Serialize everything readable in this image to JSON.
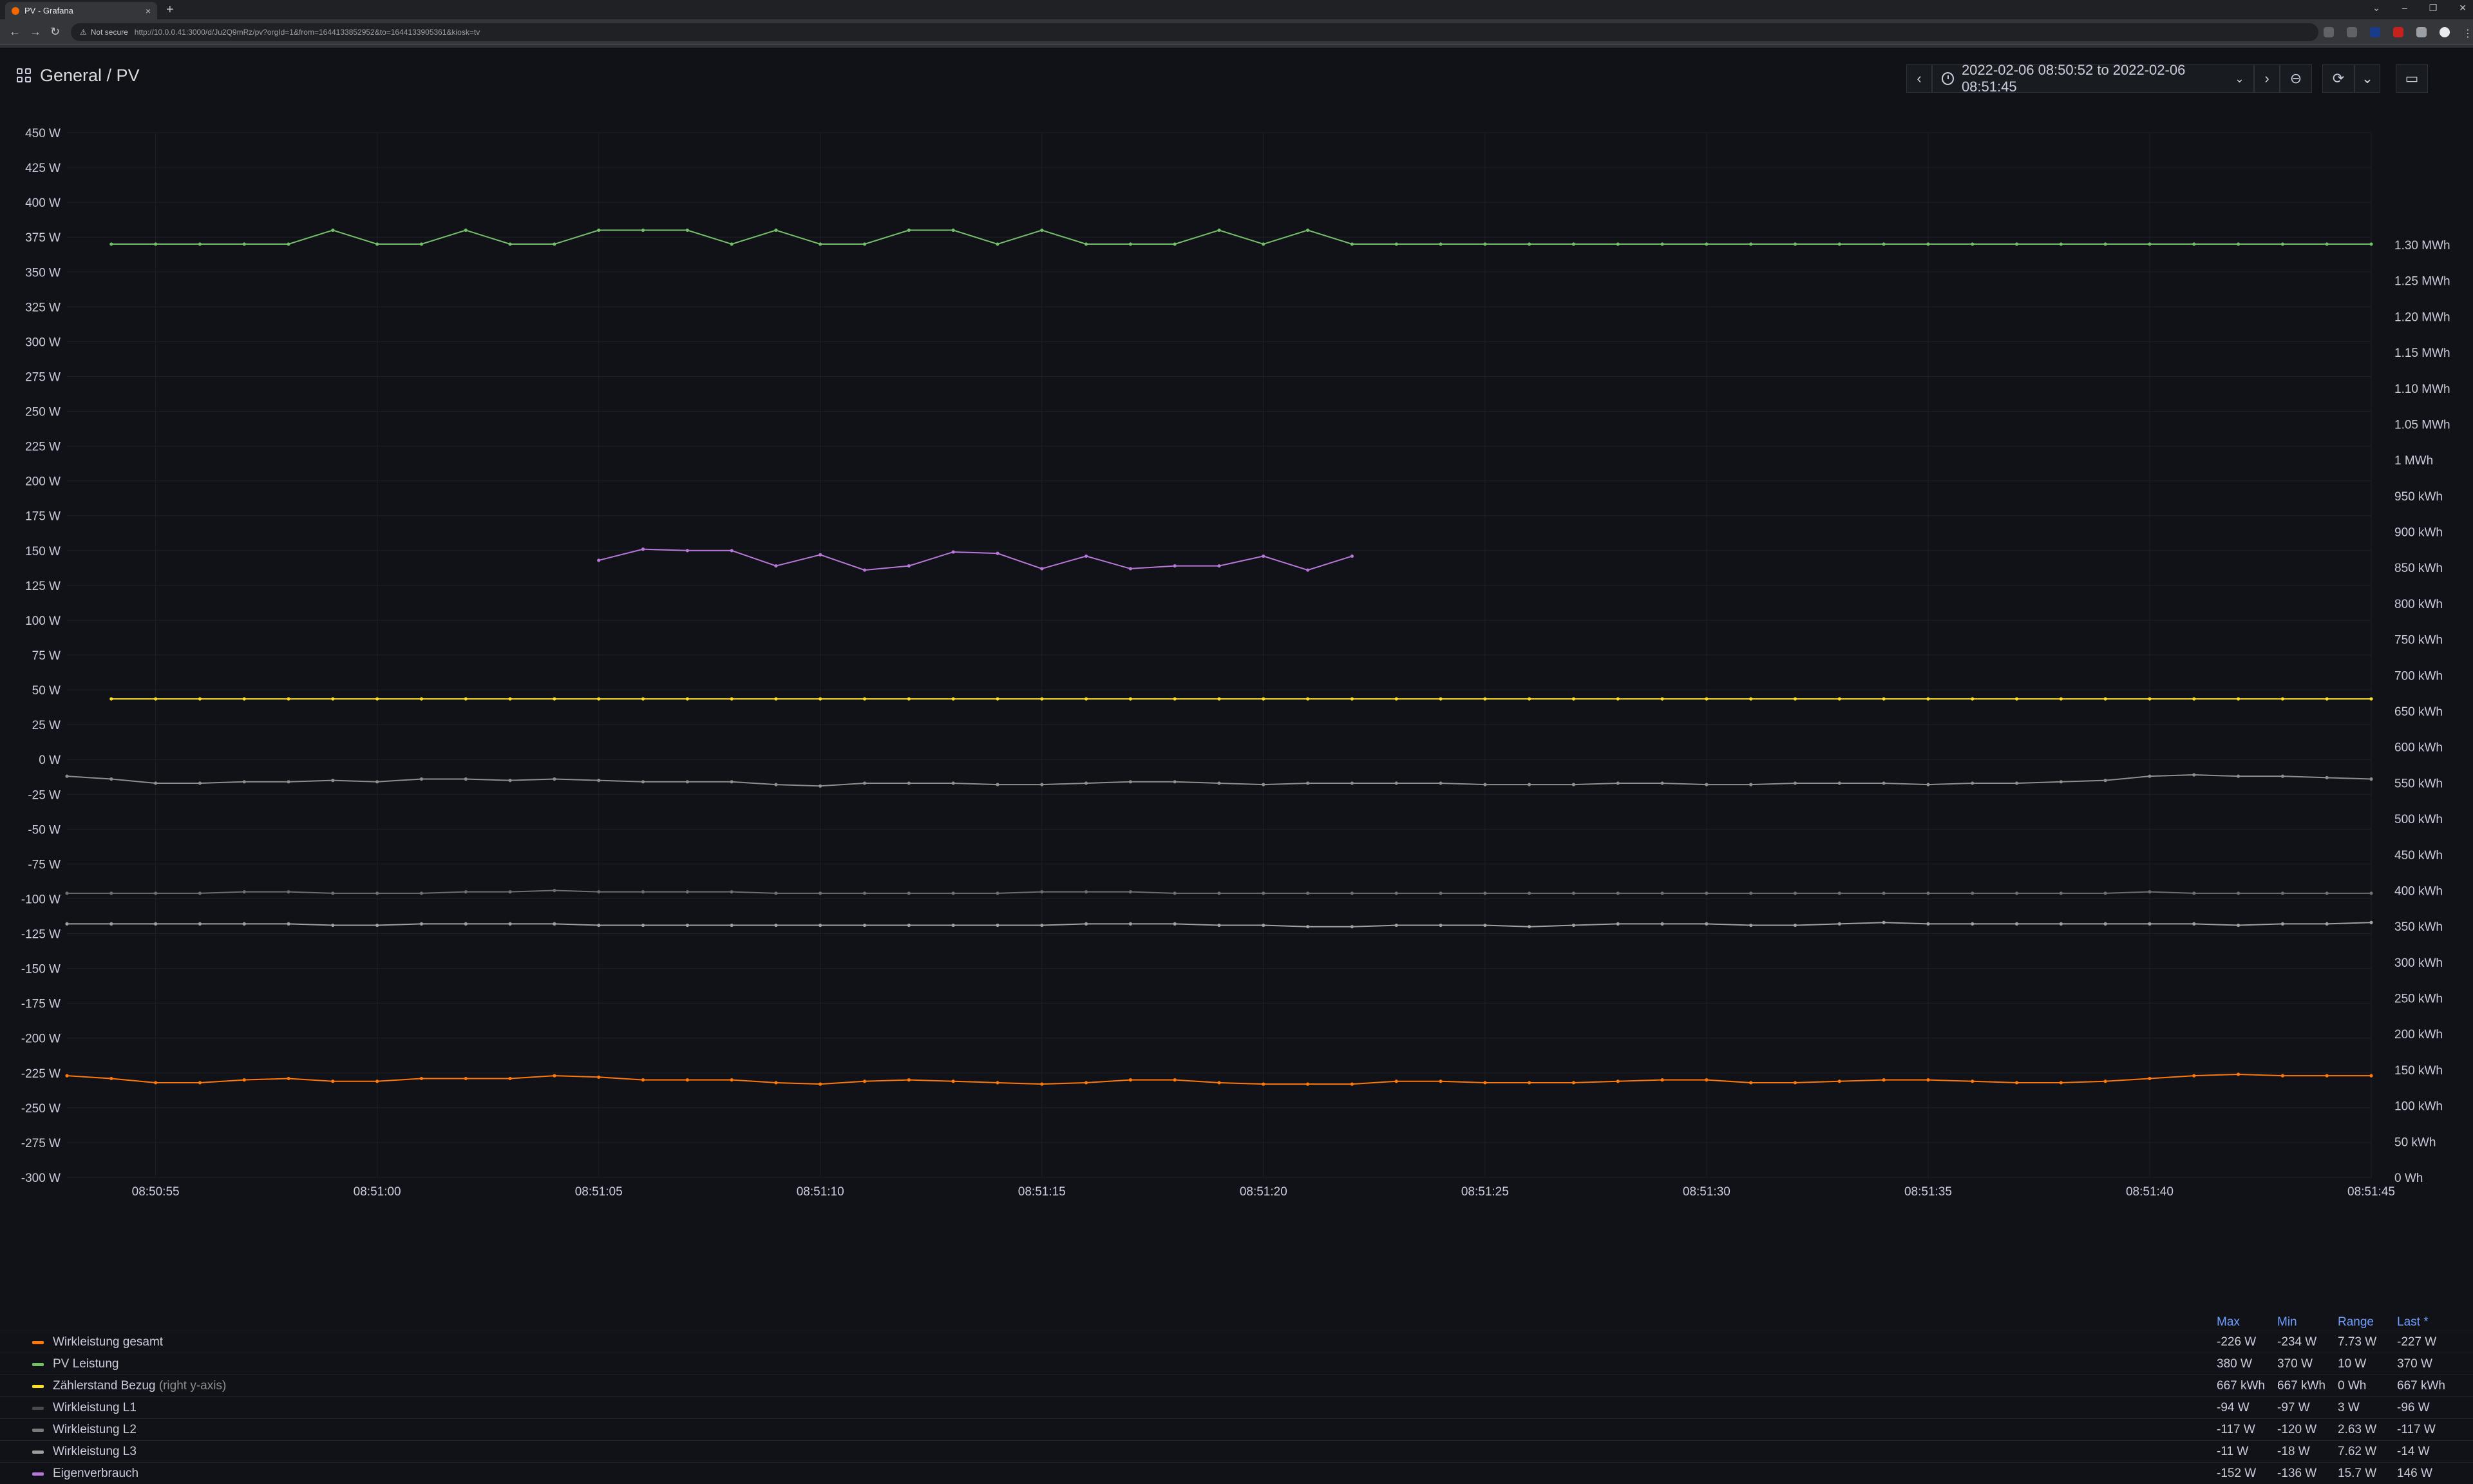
{
  "browser": {
    "tab_title": "PV - Grafana",
    "tab_close": "×",
    "new_tab": "+",
    "security_label": "Not secure",
    "url": "http://10.0.0.41:3000/d/Ju2Q9mRz/pv?orgId=1&from=1644133852952&to=1644133905361&kiosk=tv",
    "window_controls": [
      "⌄",
      "–",
      "❐",
      "✕"
    ]
  },
  "header": {
    "breadcrumb": "General  / PV",
    "time_range": "2022-02-06 08:50:52 to 2022-02-06 08:51:45",
    "prev": "‹",
    "next": "›",
    "chevron": "⌄",
    "zoom": "⊖",
    "refresh": "⟳",
    "tv": "▭"
  },
  "chart_data": {
    "type": "line",
    "x": [
      "08:50:53",
      "08:50:54",
      "08:50:55",
      "08:50:56",
      "08:50:57",
      "08:50:58",
      "08:50:59",
      "08:51:00",
      "08:51:01",
      "08:51:02",
      "08:51:03",
      "08:51:04",
      "08:51:05",
      "08:51:06",
      "08:51:07",
      "08:51:08",
      "08:51:09",
      "08:51:10",
      "08:51:11",
      "08:51:12",
      "08:51:13",
      "08:51:14",
      "08:51:15",
      "08:51:16",
      "08:51:17",
      "08:51:18",
      "08:51:19",
      "08:51:20",
      "08:51:21",
      "08:51:22",
      "08:51:23",
      "08:51:24",
      "08:51:25",
      "08:51:26",
      "08:51:27",
      "08:51:28",
      "08:51:29",
      "08:51:30",
      "08:51:31",
      "08:51:32",
      "08:51:33",
      "08:51:34",
      "08:51:35",
      "08:51:36",
      "08:51:37",
      "08:51:38",
      "08:51:39",
      "08:51:40",
      "08:51:41",
      "08:51:42",
      "08:51:43",
      "08:51:44",
      "08:51:45"
    ],
    "x_ticks": [
      "08:50:55",
      "08:51:00",
      "08:51:05",
      "08:51:10",
      "08:51:15",
      "08:51:20",
      "08:51:25",
      "08:51:30",
      "08:51:35",
      "08:51:40",
      "08:51:45"
    ],
    "y_left": {
      "min": -300,
      "max": 450,
      "step": 25,
      "unit": " W"
    },
    "y_right": {
      "min": 0,
      "max": 1300,
      "step": 50
    },
    "y_right_labels": [
      "0 Wh",
      "50 kWh",
      "100 kWh",
      "150 kWh",
      "200 kWh",
      "250 kWh",
      "300 kWh",
      "350 kWh",
      "400 kWh",
      "450 kWh",
      "500 kWh",
      "550 kWh",
      "600 kWh",
      "650 kWh",
      "700 kWh",
      "750 kWh",
      "800 kWh",
      "850 kWh",
      "900 kWh",
      "950 kWh",
      "1 MWh",
      "1.05 MWh",
      "1.10 MWh",
      "1.15 MWh",
      "1.20 MWh",
      "1.25 MWh",
      "1.30 MWh"
    ],
    "grid": true,
    "series": [
      {
        "name": "PV Leistung",
        "axis": "left",
        "color": "#73bf69",
        "start": 1,
        "values": [
          370,
          370,
          370,
          370,
          370,
          380,
          370,
          370,
          380,
          370,
          370,
          380,
          380,
          380,
          370,
          380,
          370,
          370,
          380,
          380,
          370,
          380,
          370,
          370,
          370,
          380,
          370,
          380,
          370,
          370,
          370,
          370,
          370,
          370,
          370,
          370,
          370,
          370,
          370,
          370,
          370,
          370,
          370,
          370,
          370,
          370,
          370,
          370,
          370,
          370,
          370,
          370
        ]
      },
      {
        "name": "Eigenverbrauch",
        "axis": "left",
        "color": "#b877d9",
        "start": 12,
        "values": [
          143,
          151,
          150,
          150,
          139,
          147,
          136,
          139,
          149,
          148,
          137,
          146,
          137,
          139,
          139,
          146,
          136,
          146
        ]
      },
      {
        "name": "Zählerstand Bezug",
        "axis": "right",
        "color": "#fade2a",
        "start": 1,
        "values": [
          667,
          667,
          667,
          667,
          667,
          667,
          667,
          667,
          667,
          667,
          667,
          667,
          667,
          667,
          667,
          667,
          667,
          667,
          667,
          667,
          667,
          667,
          667,
          667,
          667,
          667,
          667,
          667,
          667,
          667,
          667,
          667,
          667,
          667,
          667,
          667,
          667,
          667,
          667,
          667,
          667,
          667,
          667,
          667,
          667,
          667,
          667,
          667,
          667,
          667,
          667,
          667
        ]
      },
      {
        "name": "Wirkleistung L3",
        "axis": "left",
        "color": "#8e8e8e",
        "start": 0,
        "values": [
          -12,
          -14,
          -17,
          -17,
          -16,
          -16,
          -15,
          -16,
          -14,
          -14,
          -15,
          -14,
          -15,
          -16,
          -16,
          -16,
          -18,
          -19,
          -17,
          -17,
          -17,
          -18,
          -18,
          -17,
          -16,
          -16,
          -17,
          -18,
          -17,
          -17,
          -17,
          -17,
          -18,
          -18,
          -18,
          -17,
          -17,
          -18,
          -18,
          -17,
          -17,
          -17,
          -18,
          -17,
          -17,
          -16,
          -15,
          -12,
          -11,
          -12,
          -12,
          -13,
          -14
        ]
      },
      {
        "name": "Wirkleistung L1",
        "axis": "left",
        "color": "#6e6e6e",
        "start": 0,
        "values": [
          -96,
          -96,
          -96,
          -96,
          -95,
          -95,
          -96,
          -96,
          -96,
          -95,
          -95,
          -94,
          -95,
          -95,
          -95,
          -95,
          -96,
          -96,
          -96,
          -96,
          -96,
          -96,
          -95,
          -95,
          -95,
          -96,
          -96,
          -96,
          -96,
          -96,
          -96,
          -96,
          -96,
          -96,
          -96,
          -96,
          -96,
          -96,
          -96,
          -96,
          -96,
          -96,
          -96,
          -96,
          -96,
          -96,
          -96,
          -95,
          -96,
          -96,
          -96,
          -96,
          -96
        ]
      },
      {
        "name": "Wirkleistung L2",
        "axis": "left",
        "color": "#a0a0a0",
        "start": 0,
        "values": [
          -118,
          -118,
          -118,
          -118,
          -118,
          -118,
          -119,
          -119,
          -118,
          -118,
          -118,
          -118,
          -119,
          -119,
          -119,
          -119,
          -119,
          -119,
          -119,
          -119,
          -119,
          -119,
          -119,
          -118,
          -118,
          -118,
          -119,
          -119,
          -120,
          -120,
          -119,
          -119,
          -119,
          -120,
          -119,
          -118,
          -118,
          -118,
          -119,
          -119,
          -118,
          -117,
          -118,
          -118,
          -118,
          -118,
          -118,
          -118,
          -118,
          -119,
          -118,
          -118,
          -117
        ]
      },
      {
        "name": "Wirkleistung gesamt",
        "axis": "left",
        "color": "#ff780a",
        "start": 0,
        "values": [
          -227,
          -229,
          -232,
          -232,
          -230,
          -229,
          -231,
          -231,
          -229,
          -229,
          -229,
          -227,
          -228,
          -230,
          -230,
          -230,
          -232,
          -233,
          -231,
          -230,
          -231,
          -232,
          -233,
          -232,
          -230,
          -230,
          -232,
          -233,
          -233,
          -233,
          -231,
          -231,
          -232,
          -232,
          -232,
          -231,
          -230,
          -230,
          -232,
          -232,
          -231,
          -230,
          -230,
          -231,
          -232,
          -232,
          -231,
          -229,
          -227,
          -226,
          -227,
          -227,
          -227
        ]
      }
    ]
  },
  "legend": {
    "headers": {
      "max": "Max",
      "min": "Min",
      "range": "Range",
      "last": "Last *"
    },
    "rows": [
      {
        "name": "Wirkleistung gesamt",
        "hint": "",
        "color": "#ff780a",
        "max": "-226 W",
        "min": "-234 W",
        "range": "7.73 W",
        "last": "-227 W"
      },
      {
        "name": "PV Leistung",
        "hint": "",
        "color": "#73bf69",
        "max": "380 W",
        "min": "370 W",
        "range": "10 W",
        "last": "370 W"
      },
      {
        "name": "Zählerstand Bezug",
        "hint": "(right y-axis)",
        "color": "#fade2a",
        "max": "667 kWh",
        "min": "667 kWh",
        "range": "0 Wh",
        "last": "667 kWh"
      },
      {
        "name": "Wirkleistung L1",
        "hint": "",
        "color": "#4a4a4a",
        "max": "-94 W",
        "min": "-97 W",
        "range": "3 W",
        "last": "-96 W"
      },
      {
        "name": "Wirkleistung L2",
        "hint": "",
        "color": "#7a7a7a",
        "max": "-117 W",
        "min": "-120 W",
        "range": "2.63 W",
        "last": "-117 W"
      },
      {
        "name": "Wirkleistung L3",
        "hint": "",
        "color": "#9e9e9e",
        "max": "-11 W",
        "min": "-18 W",
        "range": "7.62 W",
        "last": "-14 W"
      },
      {
        "name": "Eigenverbrauch",
        "hint": "",
        "color": "#b877d9",
        "max": "-152 W",
        "min": "-136 W",
        "range": "15.7 W",
        "last": "146 W"
      }
    ]
  }
}
